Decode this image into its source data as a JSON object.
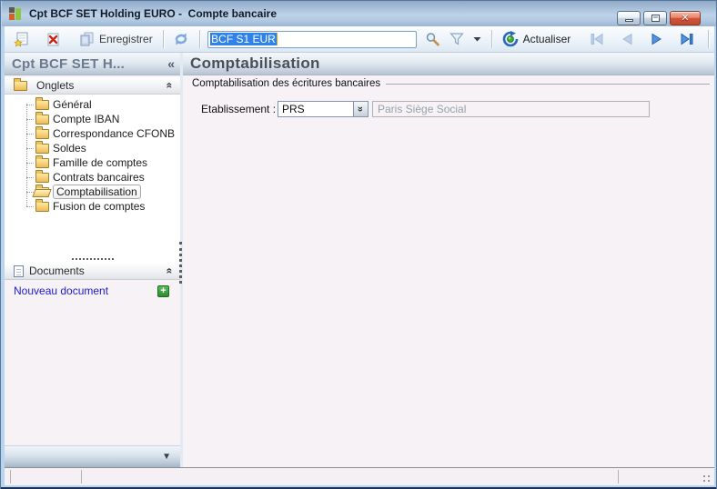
{
  "window": {
    "title": "Cpt BCF SET Holding EURO -  Compte bancaire"
  },
  "toolbar": {
    "save_label": "Enregistrer",
    "search_value": "BCF S1 EUR",
    "refresh_label": "Actualiser"
  },
  "sidebar": {
    "title": "Cpt BCF SET H...",
    "onglets": {
      "label": "Onglets",
      "items": [
        {
          "label": "Général"
        },
        {
          "label": "Compte IBAN"
        },
        {
          "label": "Correspondance CFONB"
        },
        {
          "label": "Soldes"
        },
        {
          "label": "Famille de comptes"
        },
        {
          "label": "Contrats bancaires"
        },
        {
          "label": "Comptabilisation",
          "selected": true
        },
        {
          "label": "Fusion de comptes"
        }
      ]
    },
    "documents": {
      "label": "Documents",
      "new_link": "Nouveau document"
    }
  },
  "main": {
    "title": "Comptabilisation",
    "fieldset_label": "Comptabilisation des écritures bancaires",
    "form": {
      "etablissement_label": "Etablissement :",
      "etablissement_value": "PRS",
      "etablissement_name": "Paris Siège Social"
    }
  },
  "icons": {
    "collapse_sidebar": "«",
    "chevron_up": "«",
    "chevron_down": "«",
    "panel_arrow_down": "▼",
    "add_plus": "+",
    "close_x": "✕"
  },
  "colors": {
    "titlebar_blue": "#a9c0da",
    "selection_blue": "#2f82e8",
    "link_blue": "#1c1ccc",
    "folder_yellow": "#eebb55",
    "close_red": "#c04a2e",
    "panel_bg": "#f6f2f6"
  }
}
